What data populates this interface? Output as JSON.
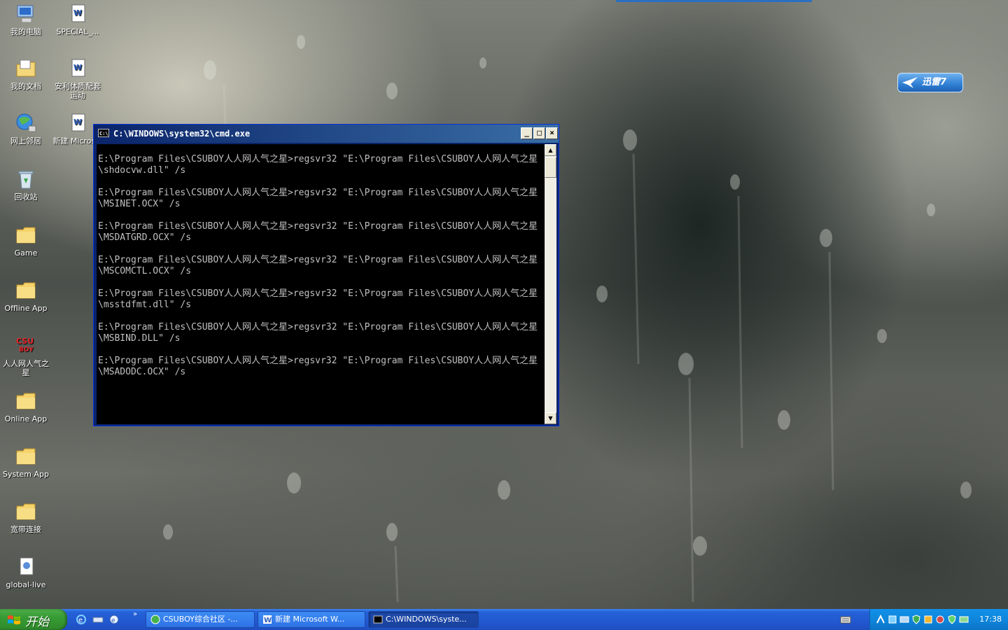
{
  "desktop": {
    "icons": [
      {
        "label": "我的电脑",
        "icon": "my-computer-icon"
      },
      {
        "label": "SPECIAL_...",
        "icon": "word-doc-icon"
      },
      {
        "label": "我的文档",
        "icon": "my-documents-icon"
      },
      {
        "label": "安利体质配套运动",
        "icon": "word-doc-icon"
      },
      {
        "label": "网上邻居",
        "icon": "network-icon"
      },
      {
        "label": "新建 Micros...",
        "icon": "word-doc-icon"
      },
      {
        "label": "回收站",
        "icon": "recycle-bin-icon"
      },
      {
        "label": "Game",
        "icon": "folder-icon"
      },
      {
        "label": "Offline App",
        "icon": "folder-icon"
      },
      {
        "label": "人人网人气之星",
        "icon": "csuboy-icon",
        "badge": "CSU BOY"
      },
      {
        "label": "Online App",
        "icon": "folder-icon"
      },
      {
        "label": "System App",
        "icon": "folder-icon"
      },
      {
        "label": "宽带连接",
        "icon": "folder-icon"
      },
      {
        "label": "global-live",
        "icon": "document-icon"
      }
    ]
  },
  "xunlei": {
    "label": "迅雷7"
  },
  "cmd_window": {
    "title": "C:\\WINDOWS\\system32\\cmd.exe",
    "icon_text": "C:\\",
    "minimize": "_",
    "maximize": "□",
    "close": "×",
    "output": "E:\\Program Files\\CSUBOY人人网人气之星>regsvr32 \"E:\\Program Files\\CSUBOY人人网人气之星\\shdocvw.dll\" /s\n\nE:\\Program Files\\CSUBOY人人网人气之星>regsvr32 \"E:\\Program Files\\CSUBOY人人网人气之星\\MSINET.OCX\" /s\n\nE:\\Program Files\\CSUBOY人人网人气之星>regsvr32 \"E:\\Program Files\\CSUBOY人人网人气之星\\MSDATGRD.OCX\" /s\n\nE:\\Program Files\\CSUBOY人人网人气之星>regsvr32 \"E:\\Program Files\\CSUBOY人人网人气之星\\MSCOMCTL.OCX\" /s\n\nE:\\Program Files\\CSUBOY人人网人气之星>regsvr32 \"E:\\Program Files\\CSUBOY人人网人气之星\\msstdfmt.dll\" /s\n\nE:\\Program Files\\CSUBOY人人网人气之星>regsvr32 \"E:\\Program Files\\CSUBOY人人网人气之星\\MSBIND.DLL\" /s\n\nE:\\Program Files\\CSUBOY人人网人气之星>regsvr32 \"E:\\Program Files\\CSUBOY人人网人气之星\\MSADODC.OCX\" /s",
    "scroll_up": "▲",
    "scroll_down": "▼"
  },
  "taskbar": {
    "start_label": "开始",
    "quicklaunch_more": "»",
    "buttons": [
      {
        "label": "CSUBOY综合社区 -...",
        "icon": "browser-icon"
      },
      {
        "label": "新建 Microsoft W...",
        "icon": "word-icon"
      },
      {
        "label": "C:\\WINDOWS\\syste...",
        "icon": "cmd-icon"
      }
    ],
    "clock": "17:38"
  },
  "colors": {
    "taskbar_blue": "#2258d0",
    "start_green": "#379b33",
    "title_blue": "#0a246a",
    "console_text": "#c0c0c0"
  }
}
